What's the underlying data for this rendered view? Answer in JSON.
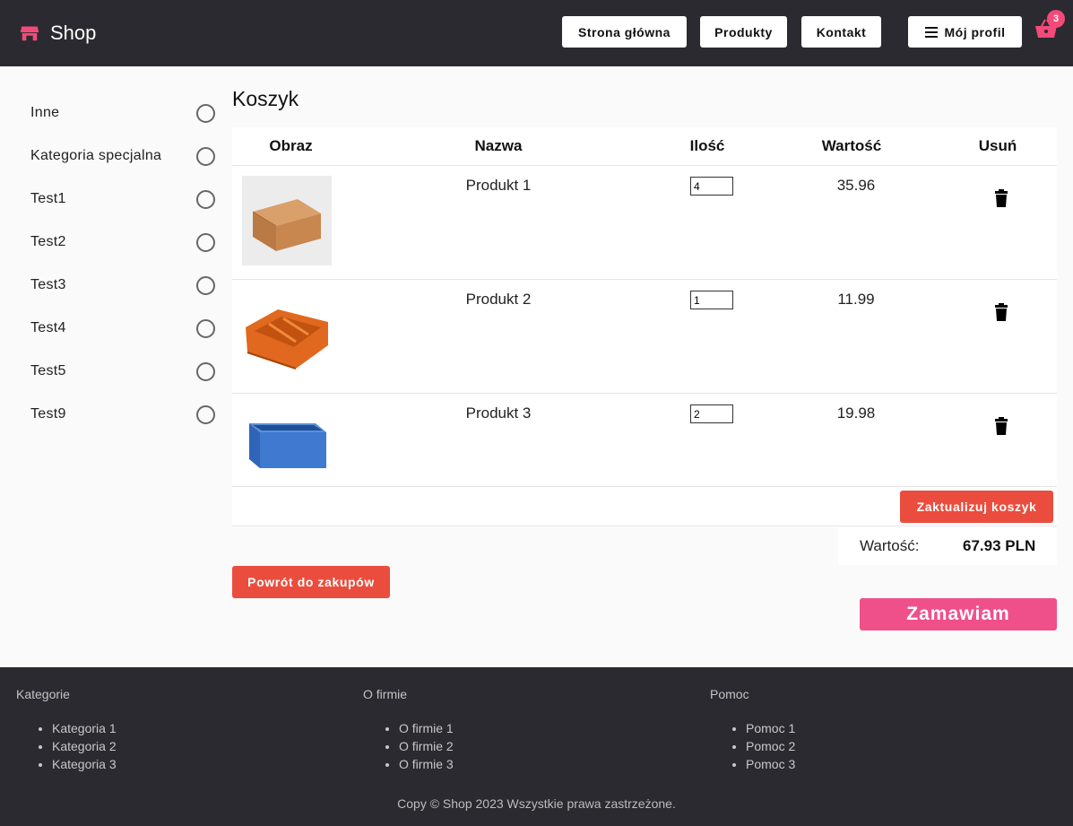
{
  "header": {
    "brand": "Shop",
    "nav": {
      "home": "Strona główna",
      "products": "Produkty",
      "contact": "Kontakt",
      "profile": "Mój profil"
    },
    "cart_count": "3",
    "colors": {
      "bar": "#2a2a30",
      "accent": "#f44a7a"
    }
  },
  "sidebar": {
    "categories": [
      {
        "label": "Inne"
      },
      {
        "label": "Kategoria specjalna"
      },
      {
        "label": "Test1"
      },
      {
        "label": "Test2"
      },
      {
        "label": "Test3"
      },
      {
        "label": "Test4"
      },
      {
        "label": "Test5"
      },
      {
        "label": "Test9"
      }
    ]
  },
  "cart": {
    "title": "Koszyk",
    "columns": {
      "image": "Obraz",
      "name": "Nazwa",
      "qty": "Ilość",
      "value": "Wartość",
      "remove": "Usuń"
    },
    "items": [
      {
        "name": "Produkt 1",
        "qty": "4",
        "value": "35.96",
        "image": "cardboard-box-image"
      },
      {
        "name": "Produkt 2",
        "qty": "1",
        "value": "11.99",
        "image": "orange-storage-bin-image"
      },
      {
        "name": "Produkt 3",
        "qty": "2",
        "value": "19.98",
        "image": "blue-container-image"
      }
    ],
    "update_label": "Zaktualizuj koszyk",
    "total_label": "Wartość:",
    "total_value": "67.93 PLN",
    "back_label": "Powrót do zakupów",
    "order_label": "Zamawiam",
    "colors": {
      "red_button": "#ea4d3d",
      "order_button": "#f0508a"
    }
  },
  "footer": {
    "columns": [
      {
        "title": "Kategorie",
        "links": [
          "Kategoria 1",
          "Kategoria 2",
          "Kategoria 3"
        ]
      },
      {
        "title": "O firmie",
        "links": [
          "O firmie 1",
          "O firmie 2",
          "O firmie 3"
        ]
      },
      {
        "title": "Pomoc",
        "links": [
          "Pomoc 1",
          "Pomoc 2",
          "Pomoc 3"
        ]
      }
    ],
    "copyright": "Copy © Shop 2023 Wszystkie prawa zastrzeżone."
  }
}
